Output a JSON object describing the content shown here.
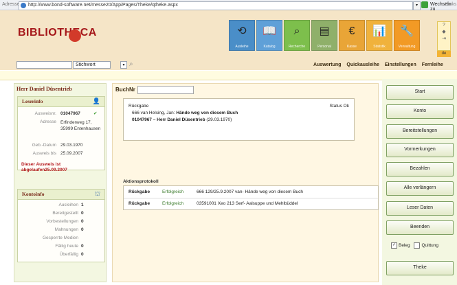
{
  "browser": {
    "address_label": "Adresse",
    "url": "http://www.bond-software.net/messe20/App/Pages/Theke/qtheke.aspx",
    "go_label": "Wechseln zu",
    "links_label": "Links"
  },
  "header": {
    "logo_text": "BIBLIOTHECA",
    "toolbar": [
      {
        "icon": "refresh-icon",
        "glyph": "⟲",
        "label": "Ausleihe",
        "color": "#4a8ec8"
      },
      {
        "icon": "book-icon",
        "glyph": "📖",
        "label": "Katalog",
        "color": "#5fa0d8"
      },
      {
        "icon": "search-icon",
        "glyph": "⌕",
        "label": "Recherche",
        "color": "#7dbf4c"
      },
      {
        "icon": "reader-icon",
        "glyph": "▤",
        "label": "Personal",
        "color": "#8fb06a"
      },
      {
        "icon": "euro-icon",
        "glyph": "€",
        "label": "Kasse",
        "color": "#e9a537"
      },
      {
        "icon": "chart-icon",
        "glyph": "📊",
        "label": "Statistik",
        "color": "#f0b23c"
      },
      {
        "icon": "tools-icon",
        "glyph": "🔧",
        "label": "Verwaltung",
        "color": "#f29a25"
      }
    ],
    "mini_buttons": [
      "?",
      "◆",
      "⇥"
    ],
    "lang": "de"
  },
  "search": {
    "value": "",
    "select_value": "Stichwort",
    "dropdown": "▾"
  },
  "menu": [
    "Auswertung",
    "Quickausleihe",
    "Einstellungen",
    "Fernleihe"
  ],
  "reader": {
    "title": "Herr Daniel Düsentrieb",
    "leserinfo": {
      "heading": "Leserinfo",
      "fields": [
        {
          "label": "Ausweisnr.",
          "value": "01047967"
        },
        {
          "label": "Adresse",
          "value": "Erfinderweg 17, 35999 Entenhausen"
        },
        {
          "label": "Geb.-Datum",
          "value": "29.03.1970"
        },
        {
          "label": "Ausweis bis",
          "value": "25.09.2007"
        }
      ],
      "warning": "Dieser Ausweis ist abgelaufen25.09.2007"
    },
    "kontoinfo": {
      "heading": "Kontoinfo",
      "fields": [
        {
          "label": "Ausleihen",
          "value": "1"
        },
        {
          "label": "Bereitgestellt",
          "value": "0"
        },
        {
          "label": "Vorbestellungen",
          "value": "0"
        },
        {
          "label": "Mahnungen",
          "value": "0"
        },
        {
          "label": "Gesperrte Medien",
          "value": ""
        },
        {
          "label": "Fällig heute",
          "value": "0"
        },
        {
          "label": "Überfällig",
          "value": "0"
        }
      ]
    }
  },
  "center": {
    "buchnr_label": "BuchNr",
    "buchnr_value": "",
    "return_box": {
      "title": "Rückgabe",
      "status": "Status Ok",
      "line1_prefix": "666  van Helsing, Jan: ",
      "line1_bold": "Hände weg von diesem Buch",
      "line2_bold": "01047967 – Herr Daniel Düsentrieb",
      "line2_suffix": " (29.03.1970)"
    },
    "protocol_label": "Aktionsprotokoll",
    "protocol_rows": [
      {
        "action": "Rückgabe",
        "result": "Erfolgreich",
        "detail": "666 129/25.9.2007  van-  Hände weg von diesem Buch"
      },
      {
        "action": "Rückgabe",
        "result": "Erfolgreich",
        "detail": "03591001  Xeo 213 Serf- Aalsuppe und Mehlbüddel"
      }
    ]
  },
  "actions": {
    "buttons": [
      "Start",
      "Konto",
      "Bereitstellungen",
      "Vormerkungen",
      "Bezahlen",
      "Alle verlängern",
      "Leser Daten",
      "Beenden"
    ],
    "checkbox_beleg": "Beleg",
    "checkbox_beleg_checked": true,
    "checkbox_quittung": "Quittung",
    "checkbox_quittung_checked": false,
    "theke_label": "Theke"
  },
  "colors": {
    "header_bg": "#f5e5c7",
    "brand_red": "#a5171a",
    "panel_green": "#f3f7e1",
    "center_bg": "#fff7e3"
  }
}
